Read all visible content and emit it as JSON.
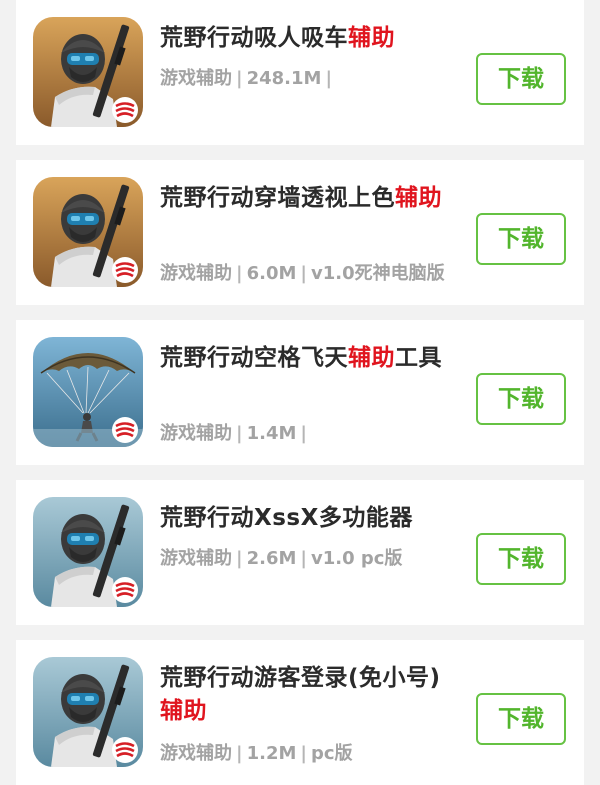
{
  "apps": [
    {
      "title_plain": "荒野行动吸人吸车",
      "title_highlight": "辅助",
      "title_tail": "",
      "category": "游戏辅助",
      "size": "248.1M",
      "version": "",
      "download_label": "下载",
      "icon": "game-soldier-icon"
    },
    {
      "title_plain": "荒野行动穿墙透视上色",
      "title_highlight": "辅助",
      "title_tail": "",
      "category": "游戏辅助",
      "size": "6.0M",
      "version": "v1.0死神电脑版",
      "download_label": "下载",
      "icon": "game-soldier-icon"
    },
    {
      "title_plain": "荒野行动空格飞天",
      "title_highlight": "辅助",
      "title_tail": "工具",
      "category": "游戏辅助",
      "size": "1.4M",
      "version": "",
      "download_label": "下载",
      "icon": "game-parachute-icon"
    },
    {
      "title_plain": "荒野行动XssX多功能器",
      "title_highlight": "",
      "title_tail": "",
      "category": "游戏辅助",
      "size": "2.6M",
      "version": "v1.0 pc版",
      "download_label": "下载",
      "icon": "game-soldier-icon"
    },
    {
      "title_plain": "荒野行动游客登录(免小号)",
      "title_highlight": "辅助",
      "title_tail": "",
      "category": "游戏辅助",
      "size": "1.2M",
      "version": "pc版",
      "download_label": "下载",
      "icon": "game-soldier-icon"
    }
  ],
  "colors": {
    "highlight": "#e0141e",
    "download_border": "#66c243",
    "download_text": "#52b52c",
    "meta_text": "#a3a3a3"
  }
}
